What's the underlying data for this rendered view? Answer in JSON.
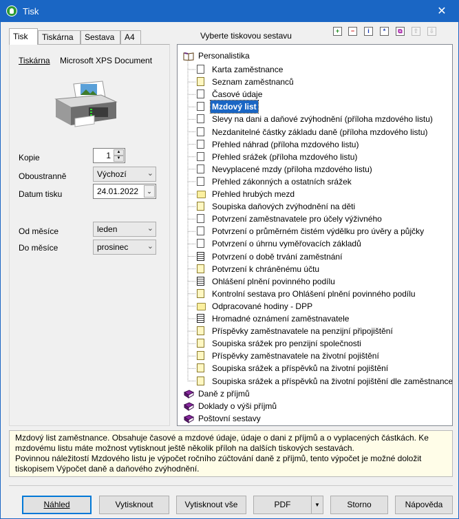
{
  "window": {
    "title": "Tisk",
    "close_glyph": "✕"
  },
  "tabs": [
    {
      "label": "Tisk",
      "active": true
    },
    {
      "label": "Tiskárna"
    },
    {
      "label": "Sestava"
    },
    {
      "label": "A4"
    }
  ],
  "left": {
    "printer_label": "Tiskárna",
    "printer_name": "Microsoft XPS Document",
    "fields": {
      "copies_label": "Kopie",
      "copies_value": "1",
      "duplex_label": "Oboustranně",
      "duplex_value": "Výchozí",
      "date_label": "Datum tisku",
      "date_value": "24.01.2022",
      "from_label": "Od měsíce",
      "from_value": "leden",
      "to_label": "Do měsíce",
      "to_value": "prosinec"
    }
  },
  "tree": {
    "heading": "Vyberte tiskovou sestavu",
    "toolbar": [
      {
        "icon": "add-icon",
        "glyph": "+"
      },
      {
        "icon": "remove-icon",
        "glyph": "−"
      },
      {
        "icon": "info-icon",
        "glyph": "i"
      },
      {
        "icon": "star-icon",
        "glyph": "*"
      },
      {
        "icon": "copy-icon",
        "glyph": "⧉"
      },
      {
        "icon": "move-up-icon",
        "glyph": "⇧",
        "disabled": true
      },
      {
        "icon": "move-down-icon",
        "glyph": "⇩",
        "disabled": true
      }
    ],
    "root": "Personalistika",
    "items": [
      {
        "label": "Karta zaměstnance",
        "icon": "page"
      },
      {
        "label": "Seznam zaměstnanců",
        "icon": "page-y"
      },
      {
        "label": "Časové údaje",
        "icon": "page"
      },
      {
        "label": "Mzdový list",
        "icon": "page",
        "selected": true
      },
      {
        "label": "Slevy na dani a daňové zvýhodnění (příloha mzdového listu)",
        "icon": "page"
      },
      {
        "label": "Nezdanitelné částky základu daně (příloha mzdového listu)",
        "icon": "page"
      },
      {
        "label": "Přehled náhrad (příloha mzdového listu)",
        "icon": "page"
      },
      {
        "label": "Přehled srážek (příloha mzdového listu)",
        "icon": "page"
      },
      {
        "label": "Nevyplacené mzdy (příloha mzdového listu)",
        "icon": "page"
      },
      {
        "label": "Přehled zákonných a ostatních srážek",
        "icon": "page"
      },
      {
        "label": "Přehled hrubých mezd",
        "icon": "folder"
      },
      {
        "label": "Soupiska daňových zvýhodnění na děti",
        "icon": "page-y"
      },
      {
        "label": "Potvrzení zaměstnavatele pro účely výživného",
        "icon": "page"
      },
      {
        "label": "Potvrzení o průměrném čistém výdělku pro úvěry a půjčky",
        "icon": "page"
      },
      {
        "label": "Potvrzení o úhrnu vyměřovacích základů",
        "icon": "page"
      },
      {
        "label": "Potvrzení o době trvání zaměstnání",
        "icon": "page-t"
      },
      {
        "label": "Potvrzení k chráněnému účtu",
        "icon": "page-y"
      },
      {
        "label": "Ohlášení plnění povinného podílu",
        "icon": "page-t"
      },
      {
        "label": "Kontrolní sestava pro Ohlášení plnění povinného podílu",
        "icon": "page-y"
      },
      {
        "label": "Odpracované hodiny - DPP",
        "icon": "folder"
      },
      {
        "label": "Hromadné oznámení zaměstnavatele",
        "icon": "page-t"
      },
      {
        "label": "Příspěvky zaměstnavatele na penzijní připojištění",
        "icon": "page-y"
      },
      {
        "label": "Soupiska srážek pro penzijní společnosti",
        "icon": "page-y"
      },
      {
        "label": "Příspěvky zaměstnavatele na životní pojištění",
        "icon": "page-y"
      },
      {
        "label": "Soupiska srážek a příspěvků na životní pojištění",
        "icon": "page-y"
      },
      {
        "label": "Soupiska srážek a příspěvků na životní pojištění dle zaměstnance",
        "icon": "page-y"
      }
    ],
    "roots2": [
      "Daně z příjmů",
      "Doklady o výši příjmů",
      "Poštovní sestavy"
    ]
  },
  "description": {
    "line1": "Mzdový list zaměstnance. Obsahuje časové a mzdové údaje, údaje o dani z příjmů a o vyplacených částkách. Ke mzdovému listu máte možnost vytisknout ještě několik příloh na dalších tiskových sestavách.",
    "line2": "Povinnou náležitostí Mzdového listu je výpočet ročního zúčtování daně z příjmů, tento výpočet je možné doložit tiskopisem Výpočet daně a daňového zvýhodnění."
  },
  "buttons": {
    "preview": "Náhled",
    "print": "Vytisknout",
    "print_all": "Vytisknout vše",
    "pdf": "PDF",
    "cancel": "Storno",
    "help": "Nápověda"
  },
  "colors": {
    "titlebar": "#1a66c4",
    "selection": "#1a66c4",
    "description_bg": "#fffde8"
  }
}
